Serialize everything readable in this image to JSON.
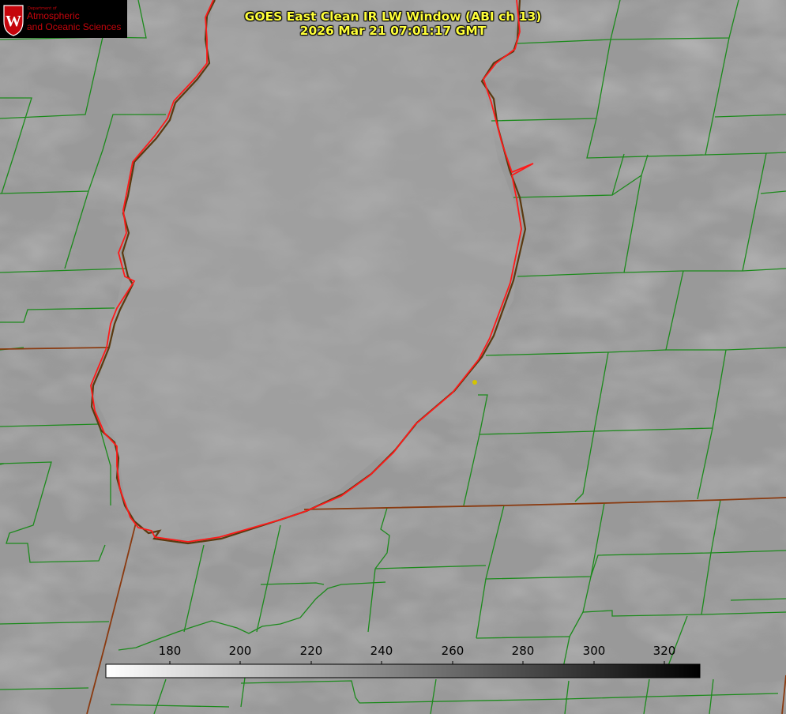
{
  "logo": {
    "dept": "Department of",
    "line1": "Atmospheric",
    "line2": "and Oceanic Sciences",
    "seal_letter": "W",
    "color": "#c5050c"
  },
  "title": {
    "line1": "GOES East Clean IR LW Window (ABI ch 13)",
    "line2": "2026 Mar 21 07:01:17 GMT"
  },
  "colorbar": {
    "ticks": [
      "180",
      "200",
      "220",
      "240",
      "260",
      "280",
      "300",
      "320"
    ],
    "colors": {
      "low": "#ffffff",
      "high": "#000000"
    }
  },
  "overlay_colors": {
    "shoreline": "#ff1a1a",
    "county_lines": "#1c8a1c",
    "state_lines": "#8a3a10",
    "marker": "#d4c400"
  }
}
